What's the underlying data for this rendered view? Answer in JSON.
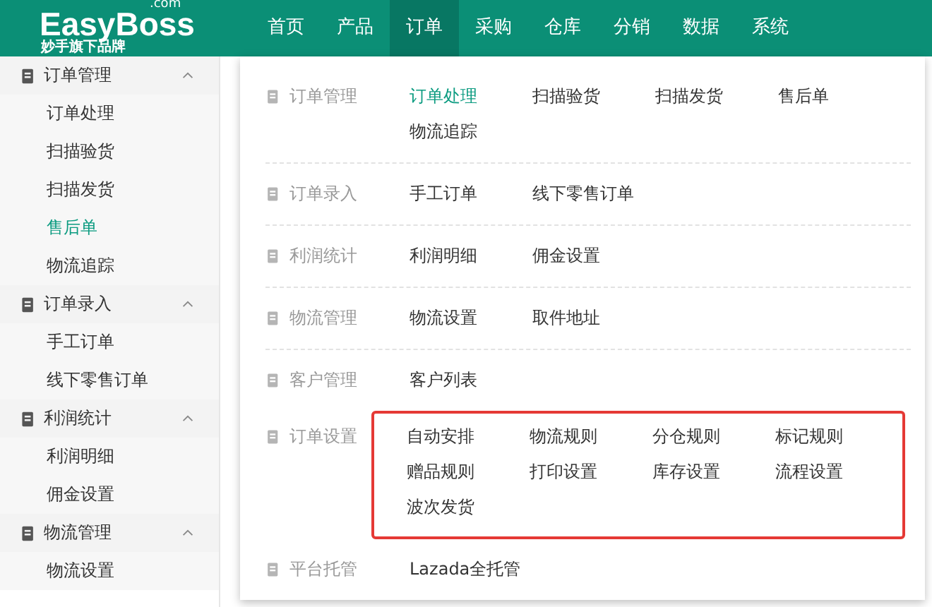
{
  "logo": {
    "name": "EasyBoss",
    "suffix": ".com",
    "tagline": "妙手旗下品牌"
  },
  "nav": [
    {
      "label": "首页",
      "selected": false
    },
    {
      "label": "产品",
      "selected": false
    },
    {
      "label": "订单",
      "selected": true
    },
    {
      "label": "采购",
      "selected": false
    },
    {
      "label": "仓库",
      "selected": false
    },
    {
      "label": "分销",
      "selected": false
    },
    {
      "label": "数据",
      "selected": false
    },
    {
      "label": "系统",
      "selected": false
    }
  ],
  "sidebar": [
    {
      "label": "订单管理",
      "expanded": true,
      "children": [
        {
          "label": "订单处理",
          "selected": false
        },
        {
          "label": "扫描验货",
          "selected": false
        },
        {
          "label": "扫描发货",
          "selected": false
        },
        {
          "label": "售后单",
          "selected": true
        },
        {
          "label": "物流追踪",
          "selected": false
        }
      ]
    },
    {
      "label": "订单录入",
      "expanded": true,
      "children": [
        {
          "label": "手工订单",
          "selected": false
        },
        {
          "label": "线下零售订单",
          "selected": false
        }
      ]
    },
    {
      "label": "利润统计",
      "expanded": true,
      "children": [
        {
          "label": "利润明细",
          "selected": false
        },
        {
          "label": "佣金设置",
          "selected": false
        }
      ]
    },
    {
      "label": "物流管理",
      "expanded": true,
      "children": [
        {
          "label": "物流设置",
          "selected": false
        }
      ]
    }
  ],
  "menu": [
    {
      "label": "订单管理",
      "highlighted": false,
      "divider": true,
      "items": [
        {
          "label": "订单处理",
          "selected": true
        },
        {
          "label": "扫描验货",
          "selected": false
        },
        {
          "label": "扫描发货",
          "selected": false
        },
        {
          "label": "售后单",
          "selected": false
        },
        {
          "label": "物流追踪",
          "selected": false
        }
      ]
    },
    {
      "label": "订单录入",
      "highlighted": false,
      "divider": true,
      "items": [
        {
          "label": "手工订单",
          "selected": false
        },
        {
          "label": "线下零售订单",
          "selected": false
        }
      ]
    },
    {
      "label": "利润统计",
      "highlighted": false,
      "divider": true,
      "items": [
        {
          "label": "利润明细",
          "selected": false
        },
        {
          "label": "佣金设置",
          "selected": false
        }
      ]
    },
    {
      "label": "物流管理",
      "highlighted": false,
      "divider": true,
      "items": [
        {
          "label": "物流设置",
          "selected": false
        },
        {
          "label": "取件地址",
          "selected": false
        }
      ]
    },
    {
      "label": "客户管理",
      "highlighted": false,
      "divider": false,
      "items": [
        {
          "label": "客户列表",
          "selected": false
        }
      ]
    },
    {
      "label": "订单设置",
      "highlighted": true,
      "divider": false,
      "items": [
        {
          "label": "自动安排",
          "selected": false
        },
        {
          "label": "物流规则",
          "selected": false
        },
        {
          "label": "分仓规则",
          "selected": false
        },
        {
          "label": "标记规则",
          "selected": false
        },
        {
          "label": "赠品规则",
          "selected": false
        },
        {
          "label": "打印设置",
          "selected": false
        },
        {
          "label": "库存设置",
          "selected": false
        },
        {
          "label": "流程设置",
          "selected": false
        },
        {
          "label": "波次发货",
          "selected": false
        }
      ]
    },
    {
      "label": "平台托管",
      "highlighted": false,
      "divider": false,
      "items": [
        {
          "label": "Lazada全托管",
          "selected": false
        }
      ]
    }
  ]
}
